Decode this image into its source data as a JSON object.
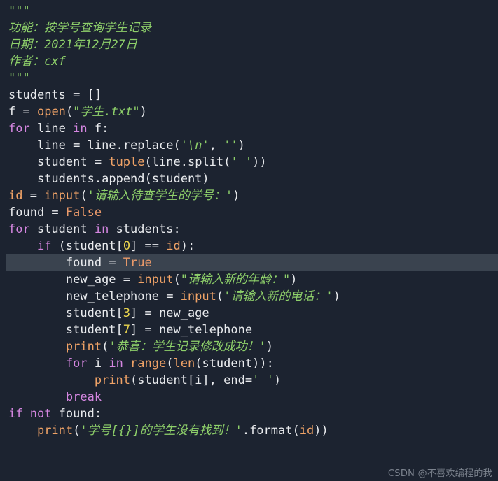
{
  "editor": {
    "theme_name": "dark-navy",
    "language": "Python",
    "background_color": "#1c2330",
    "current_line_highlight_color": "#3a434f",
    "default_text_color": "#e8eaed",
    "colors": {
      "keyword": "#d486e0",
      "builtin": "#f0a367",
      "constant": "#eb9a6a",
      "number": "#e9d44e",
      "string": "#8ed06a",
      "plain": "#e8eaed",
      "watermark": "#7c838e"
    },
    "current_line_number": 13
  },
  "code": {
    "lines": [
      {
        "n": 1,
        "indent": 0,
        "current": false,
        "tokens": [
          {
            "t": "docq",
            "v": "\"\"\""
          }
        ]
      },
      {
        "n": 2,
        "indent": 0,
        "current": false,
        "tokens": [
          {
            "t": "doc",
            "v": "功能：按学号查询学生记录"
          }
        ]
      },
      {
        "n": 3,
        "indent": 0,
        "current": false,
        "tokens": [
          {
            "t": "doc",
            "v": "日期：2021年12月27日"
          }
        ]
      },
      {
        "n": 4,
        "indent": 0,
        "current": false,
        "tokens": [
          {
            "t": "doc",
            "v": "作者：cxf"
          }
        ]
      },
      {
        "n": 5,
        "indent": 0,
        "current": false,
        "tokens": [
          {
            "t": "docq",
            "v": "\"\"\""
          }
        ]
      },
      {
        "n": 6,
        "indent": 0,
        "current": false,
        "tokens": [
          {
            "t": "plain",
            "v": "students "
          },
          {
            "t": "punct",
            "v": "= "
          },
          {
            "t": "punct",
            "v": "[]"
          }
        ]
      },
      {
        "n": 7,
        "indent": 0,
        "current": false,
        "tokens": [
          {
            "t": "plain",
            "v": "f "
          },
          {
            "t": "punct",
            "v": "= "
          },
          {
            "t": "builtin",
            "v": "open"
          },
          {
            "t": "punct",
            "v": "("
          },
          {
            "t": "str",
            "v": "\"学生.txt\""
          },
          {
            "t": "punct",
            "v": ")"
          }
        ]
      },
      {
        "n": 8,
        "indent": 0,
        "current": false,
        "tokens": [
          {
            "t": "kw",
            "v": "for "
          },
          {
            "t": "plain",
            "v": "line "
          },
          {
            "t": "kw",
            "v": "in "
          },
          {
            "t": "plain",
            "v": "f"
          },
          {
            "t": "punct",
            "v": ":"
          }
        ]
      },
      {
        "n": 9,
        "indent": 1,
        "current": false,
        "tokens": [
          {
            "t": "plain",
            "v": "line "
          },
          {
            "t": "punct",
            "v": "= "
          },
          {
            "t": "plain",
            "v": "line"
          },
          {
            "t": "punct",
            "v": "."
          },
          {
            "t": "plain",
            "v": "replace"
          },
          {
            "t": "punct",
            "v": "("
          },
          {
            "t": "str",
            "v": "'\\n'"
          },
          {
            "t": "punct",
            "v": ", "
          },
          {
            "t": "str",
            "v": "''"
          },
          {
            "t": "punct",
            "v": ")"
          }
        ]
      },
      {
        "n": 10,
        "indent": 1,
        "current": false,
        "tokens": [
          {
            "t": "plain",
            "v": "student "
          },
          {
            "t": "punct",
            "v": "= "
          },
          {
            "t": "builtin",
            "v": "tuple"
          },
          {
            "t": "punct",
            "v": "("
          },
          {
            "t": "plain",
            "v": "line"
          },
          {
            "t": "punct",
            "v": "."
          },
          {
            "t": "plain",
            "v": "split"
          },
          {
            "t": "punct",
            "v": "("
          },
          {
            "t": "str",
            "v": "' '"
          },
          {
            "t": "punct",
            "v": "))"
          }
        ]
      },
      {
        "n": 11,
        "indent": 1,
        "current": false,
        "tokens": [
          {
            "t": "plain",
            "v": "students"
          },
          {
            "t": "punct",
            "v": "."
          },
          {
            "t": "plain",
            "v": "append"
          },
          {
            "t": "punct",
            "v": "("
          },
          {
            "t": "plain",
            "v": "student"
          },
          {
            "t": "punct",
            "v": ")"
          }
        ]
      },
      {
        "n": 12,
        "indent": 0,
        "current": false,
        "tokens": [
          {
            "t": "builtin",
            "v": "id "
          },
          {
            "t": "punct",
            "v": "= "
          },
          {
            "t": "builtin",
            "v": "input"
          },
          {
            "t": "punct",
            "v": "("
          },
          {
            "t": "str",
            "v": "'请输入待查学生的学号：'"
          },
          {
            "t": "punct",
            "v": ")"
          }
        ]
      },
      {
        "n": 13,
        "indent": 0,
        "current": false,
        "tokens": [
          {
            "t": "plain",
            "v": "found "
          },
          {
            "t": "punct",
            "v": "= "
          },
          {
            "t": "const",
            "v": "False"
          }
        ]
      },
      {
        "n": 14,
        "indent": 0,
        "current": false,
        "tokens": [
          {
            "t": "kw",
            "v": "for "
          },
          {
            "t": "plain",
            "v": "student "
          },
          {
            "t": "kw",
            "v": "in "
          },
          {
            "t": "plain",
            "v": "students"
          },
          {
            "t": "punct",
            "v": ":"
          }
        ]
      },
      {
        "n": 15,
        "indent": 1,
        "current": false,
        "tokens": [
          {
            "t": "kw",
            "v": "if "
          },
          {
            "t": "punct",
            "v": "("
          },
          {
            "t": "plain",
            "v": "student"
          },
          {
            "t": "punct",
            "v": "["
          },
          {
            "t": "num",
            "v": "0"
          },
          {
            "t": "punct",
            "v": "] == "
          },
          {
            "t": "builtin",
            "v": "id"
          },
          {
            "t": "punct",
            "v": "):"
          }
        ]
      },
      {
        "n": 16,
        "indent": 2,
        "current": true,
        "tokens": [
          {
            "t": "plain",
            "v": "found "
          },
          {
            "t": "punct",
            "v": "= "
          },
          {
            "t": "const",
            "v": "True"
          }
        ]
      },
      {
        "n": 17,
        "indent": 2,
        "current": false,
        "tokens": [
          {
            "t": "plain",
            "v": "new_age "
          },
          {
            "t": "punct",
            "v": "= "
          },
          {
            "t": "builtin",
            "v": "input"
          },
          {
            "t": "punct",
            "v": "("
          },
          {
            "t": "str",
            "v": "\"请输入新的年龄：\""
          },
          {
            "t": "punct",
            "v": ")"
          }
        ]
      },
      {
        "n": 18,
        "indent": 2,
        "current": false,
        "tokens": [
          {
            "t": "plain",
            "v": "new_telephone "
          },
          {
            "t": "punct",
            "v": "= "
          },
          {
            "t": "builtin",
            "v": "input"
          },
          {
            "t": "punct",
            "v": "("
          },
          {
            "t": "str",
            "v": "'请输入新的电话：'"
          },
          {
            "t": "punct",
            "v": ")"
          }
        ]
      },
      {
        "n": 19,
        "indent": 2,
        "current": false,
        "tokens": [
          {
            "t": "plain",
            "v": "student"
          },
          {
            "t": "punct",
            "v": "["
          },
          {
            "t": "num",
            "v": "3"
          },
          {
            "t": "punct",
            "v": "] = "
          },
          {
            "t": "plain",
            "v": "new_age"
          }
        ]
      },
      {
        "n": 20,
        "indent": 2,
        "current": false,
        "tokens": [
          {
            "t": "plain",
            "v": "student"
          },
          {
            "t": "punct",
            "v": "["
          },
          {
            "t": "num",
            "v": "7"
          },
          {
            "t": "punct",
            "v": "] = "
          },
          {
            "t": "plain",
            "v": "new_telephone"
          }
        ]
      },
      {
        "n": 21,
        "indent": 2,
        "current": false,
        "tokens": [
          {
            "t": "builtin",
            "v": "print"
          },
          {
            "t": "punct",
            "v": "("
          },
          {
            "t": "str",
            "v": "'恭喜：学生记录修改成功！'"
          },
          {
            "t": "punct",
            "v": ")"
          }
        ]
      },
      {
        "n": 22,
        "indent": 2,
        "current": false,
        "tokens": [
          {
            "t": "kw",
            "v": "for "
          },
          {
            "t": "plain",
            "v": "i "
          },
          {
            "t": "kw",
            "v": "in "
          },
          {
            "t": "builtin",
            "v": "range"
          },
          {
            "t": "punct",
            "v": "("
          },
          {
            "t": "builtin",
            "v": "len"
          },
          {
            "t": "punct",
            "v": "("
          },
          {
            "t": "plain",
            "v": "student"
          },
          {
            "t": "punct",
            "v": ")):"
          }
        ]
      },
      {
        "n": 23,
        "indent": 3,
        "current": false,
        "tokens": [
          {
            "t": "builtin",
            "v": "print"
          },
          {
            "t": "punct",
            "v": "("
          },
          {
            "t": "plain",
            "v": "student"
          },
          {
            "t": "punct",
            "v": "["
          },
          {
            "t": "plain",
            "v": "i"
          },
          {
            "t": "punct",
            "v": "], "
          },
          {
            "t": "plain",
            "v": "end"
          },
          {
            "t": "punct",
            "v": "="
          },
          {
            "t": "str",
            "v": "' '"
          },
          {
            "t": "punct",
            "v": ")"
          }
        ]
      },
      {
        "n": 24,
        "indent": 2,
        "current": false,
        "tokens": [
          {
            "t": "kw",
            "v": "break"
          }
        ]
      },
      {
        "n": 25,
        "indent": 0,
        "current": false,
        "tokens": [
          {
            "t": "kw",
            "v": "if "
          },
          {
            "t": "kw",
            "v": "not "
          },
          {
            "t": "plain",
            "v": "found"
          },
          {
            "t": "punct",
            "v": ":"
          }
        ]
      },
      {
        "n": 26,
        "indent": 1,
        "current": false,
        "tokens": [
          {
            "t": "builtin",
            "v": "print"
          },
          {
            "t": "punct",
            "v": "("
          },
          {
            "t": "str",
            "v": "'学号[{}]的学生没有找到！'"
          },
          {
            "t": "punct",
            "v": "."
          },
          {
            "t": "plain",
            "v": "format"
          },
          {
            "t": "punct",
            "v": "("
          },
          {
            "t": "builtin",
            "v": "id"
          },
          {
            "t": "punct",
            "v": "))"
          }
        ]
      }
    ]
  },
  "watermark": {
    "text": "CSDN @不喜欢编程的我"
  }
}
